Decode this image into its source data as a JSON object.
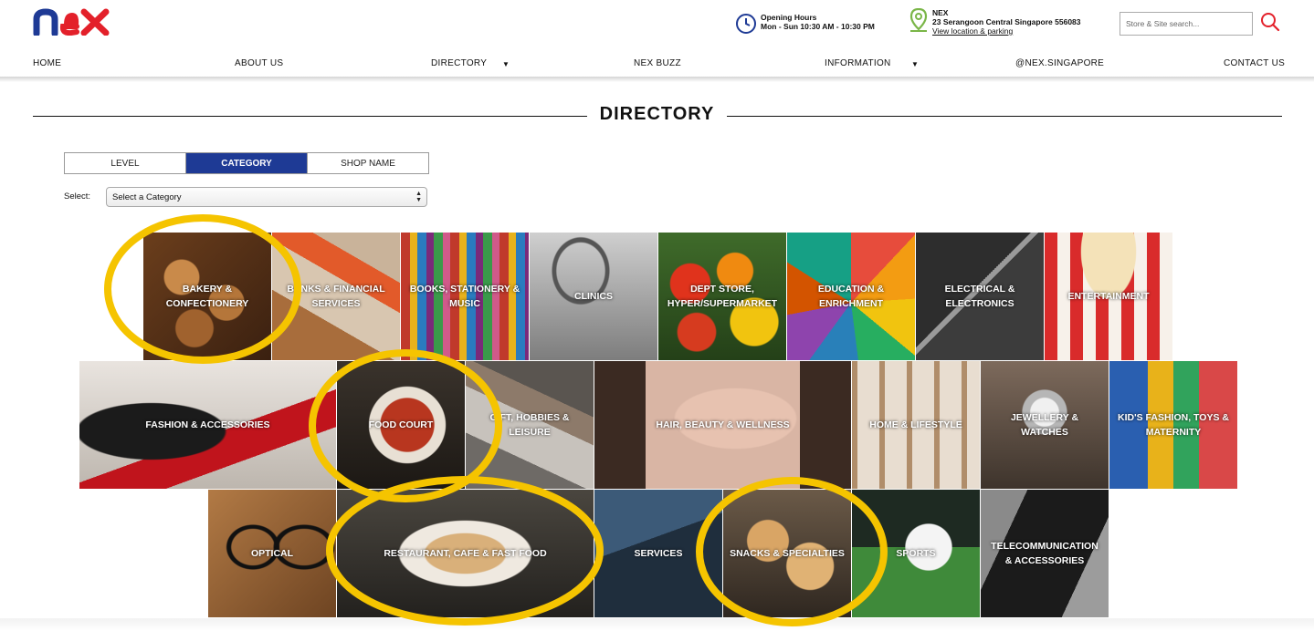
{
  "header": {
    "logo_text": "nex",
    "opening_hours": {
      "title": "Opening Hours",
      "value": "Mon - Sun 10:30 AM - 10:30 PM",
      "icon": "clock-icon"
    },
    "location": {
      "name": "NEX",
      "address": "23 Serangoon Central Singapore 556083",
      "link": "View location & parking",
      "icon": "map-pin-icon"
    },
    "search": {
      "placeholder": "Store & Site search...",
      "icon": "search-icon"
    }
  },
  "nav": {
    "items": [
      {
        "label": "HOME"
      },
      {
        "label": "ABOUT US"
      },
      {
        "label": "DIRECTORY",
        "caret": "▼"
      },
      {
        "label": "NEX BUZZ"
      },
      {
        "label": "INFORMATION",
        "caret": "▼"
      },
      {
        "label": "@NEX.SINGAPORE"
      },
      {
        "label": "CONTACT US"
      }
    ]
  },
  "page": {
    "title": "DIRECTORY"
  },
  "tabs": [
    {
      "label": "LEVEL",
      "active": false
    },
    {
      "label": "CATEGORY",
      "active": true
    },
    {
      "label": "SHOP NAME",
      "active": false
    }
  ],
  "select": {
    "label": "Select:",
    "value": "Select a Category"
  },
  "categories": [
    {
      "label": "BAKERY & CONFECTIONERY",
      "highlighted": true
    },
    {
      "label": "BANKS & FINANCIAL SERVICES",
      "highlighted": false
    },
    {
      "label": "BOOKS, STATIONERY & MUSIC",
      "highlighted": false
    },
    {
      "label": "CLINICS",
      "highlighted": false
    },
    {
      "label": "DEPT STORE, HYPER/SUPERMARKET",
      "highlighted": false
    },
    {
      "label": "EDUCATION & ENRICHMENT",
      "highlighted": false
    },
    {
      "label": "ELECTRICAL & ELECTRONICS",
      "highlighted": false
    },
    {
      "label": "ENTERTAINMENT",
      "highlighted": false
    },
    {
      "label": "FASHION & ACCESSORIES",
      "highlighted": false
    },
    {
      "label": "FOOD COURT",
      "highlighted": true
    },
    {
      "label": "GIFT, HOBBIES & LEISURE",
      "highlighted": false
    },
    {
      "label": "HAIR, BEAUTY & WELLNESS",
      "highlighted": false
    },
    {
      "label": "HOME & LIFESTYLE",
      "highlighted": false
    },
    {
      "label": "JEWELLERY & WATCHES",
      "highlighted": false
    },
    {
      "label": "KID'S FASHION, TOYS & MATERNITY",
      "highlighted": false
    },
    {
      "label": "OPTICAL",
      "highlighted": false
    },
    {
      "label": "RESTAURANT, CAFE & FAST FOOD",
      "highlighted": true
    },
    {
      "label": "SERVICES",
      "highlighted": false
    },
    {
      "label": "SNACKS & SPECIALTIES",
      "highlighted": true
    },
    {
      "label": "SPORTS",
      "highlighted": false
    },
    {
      "label": "TELECOMMUNICATION & ACCESSORIES",
      "highlighted": false
    }
  ],
  "colors": {
    "brand_blue": "#1e3a95",
    "brand_red": "#e3202a",
    "highlight_yellow": "#f5c400",
    "location_green": "#7ab648"
  }
}
